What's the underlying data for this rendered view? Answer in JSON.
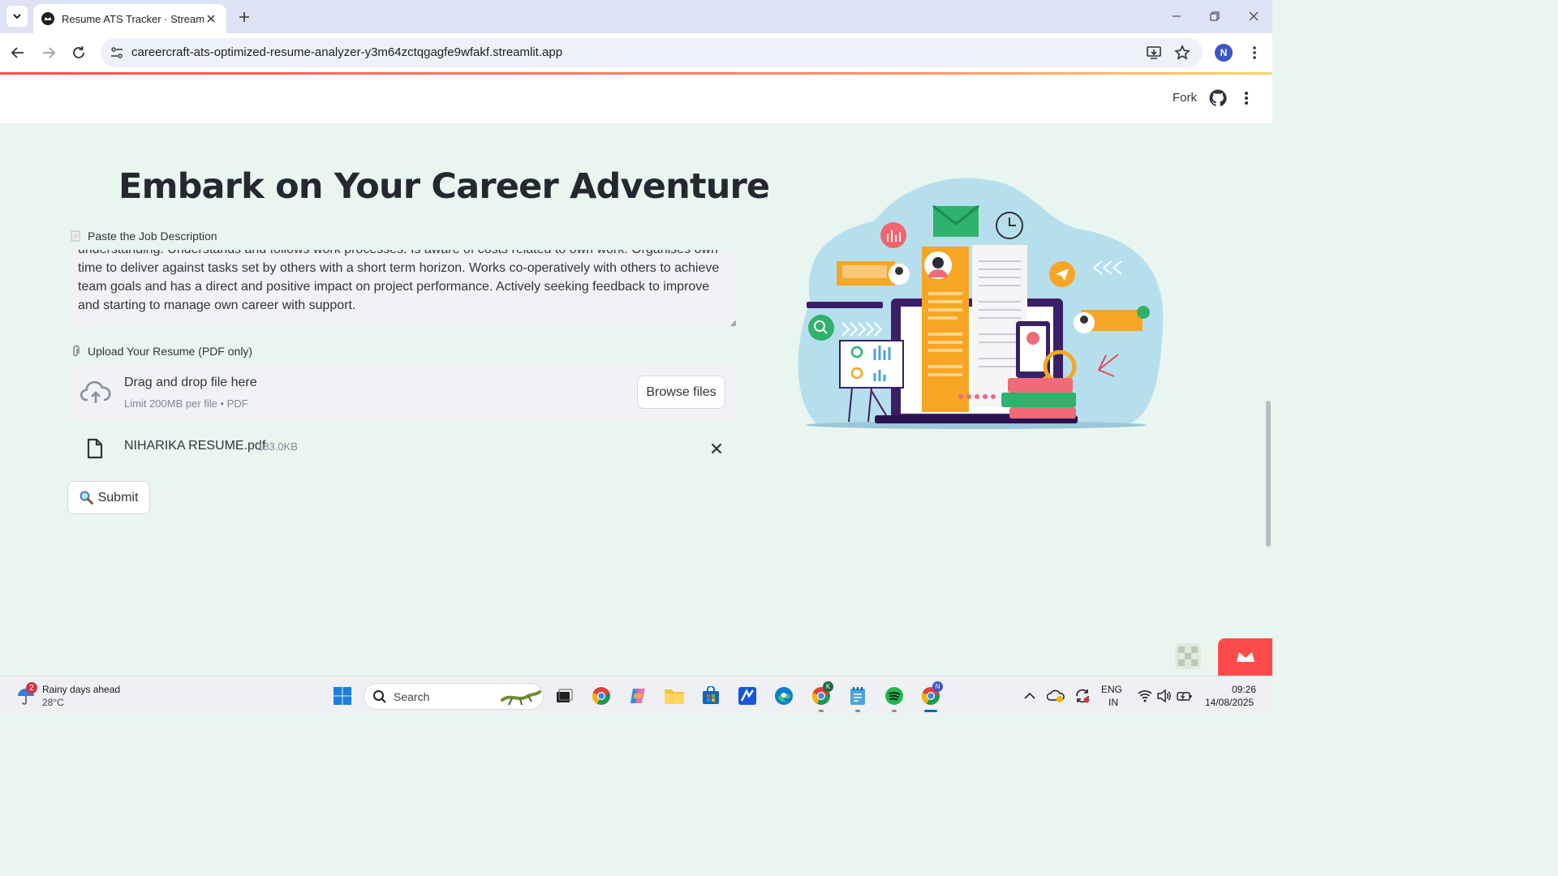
{
  "browser": {
    "tab_title": "Resume ATS Tracker · Streamlit",
    "url": "careercraft-ats-optimized-resume-analyzer-y3m64zctqgagfe9wfakf.streamlit.app",
    "profile_initial": "N"
  },
  "header": {
    "fork_label": "Fork"
  },
  "main": {
    "title": "Embark on Your Career Adventure",
    "job_description": {
      "label": "Paste the Job Description",
      "text": "understanding. Understands and follows work processes. Is aware of costs related to own work. Organises own time to deliver against tasks set by others with a short term horizon. Works co-operatively with others to achieve team goals and has a direct and positive impact on project performance. Actively seeking feedback to improve and starting to manage own career with support."
    },
    "upload": {
      "label": "Upload Your Resume (PDF only)",
      "drop_text": "Drag and drop file here",
      "limit_text": "Limit 200MB per file • PDF",
      "browse_label": "Browse files"
    },
    "uploaded_file": {
      "name": "NIHARIKA RESUME.pdf",
      "size": "183.0KB"
    },
    "submit_label": "Submit"
  },
  "taskbar": {
    "weather_title": "Rainy days ahead",
    "weather_temp": "28°C",
    "weather_badge": "2",
    "search_label": "Search",
    "lang_top": "ENG",
    "lang_bottom": "IN",
    "time": "09:26",
    "date": "14/08/2025",
    "chrome_profile_k": "K",
    "chrome_profile_n": "N"
  },
  "colors": {
    "accent": "#ff4b4b",
    "page_bg": "#e8f6ef",
    "input_bg": "#f0f2f6",
    "text": "#31333f"
  }
}
